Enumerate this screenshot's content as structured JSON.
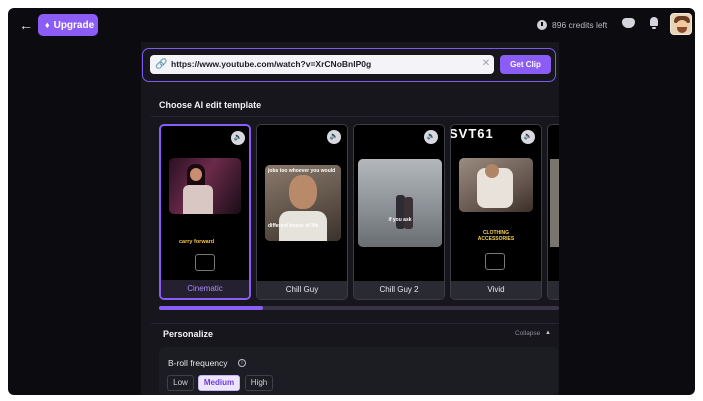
{
  "topbar": {
    "back_icon": "arrow-left-icon",
    "upgrade_label": "Upgrade",
    "credits_text": "896 credits left"
  },
  "url_bar": {
    "value": "https://www.youtube.com/watch?v=XrCNoBnlP0g",
    "button_label": "Get Clip"
  },
  "templates": {
    "title": "Choose AI edit template",
    "cards": [
      {
        "label": "Cinematic",
        "selected": true,
        "caption": "carry forward"
      },
      {
        "label": "Chill Guy",
        "selected": false,
        "caption_top": "jobs too whoever you would",
        "caption_bottom": "different boxes of life"
      },
      {
        "label": "Chill Guy 2",
        "selected": false,
        "caption": "if you ask"
      },
      {
        "label": "Vivid",
        "selected": false,
        "caption": "CLOTHING ACCESSORIES",
        "overlay_text": "SVT61"
      }
    ],
    "scroll_fraction": 0.26
  },
  "personalize": {
    "title": "Personalize",
    "collapse_label": "Collapse",
    "broll_label": "B-roll frequency",
    "options": [
      "Low",
      "Medium",
      "High"
    ],
    "selected": "Medium"
  },
  "colors": {
    "accent": "#8b5cf6",
    "background": "#0b0b10",
    "panel": "#16161c"
  }
}
